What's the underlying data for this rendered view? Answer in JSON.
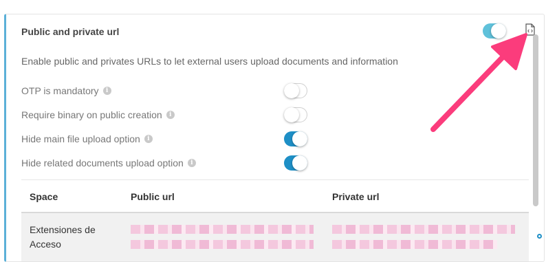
{
  "section": {
    "title": "Public and private url",
    "description": "Enable public and privates URLs to let external users upload documents and information",
    "main_toggle_on": true
  },
  "options": [
    {
      "label": "OTP is mandatory",
      "enabled": false
    },
    {
      "label": "Require binary on public creation",
      "enabled": false
    },
    {
      "label": "Hide main file upload option",
      "enabled": true
    },
    {
      "label": "Hide related documents upload option",
      "enabled": true
    }
  ],
  "table": {
    "headers": {
      "space": "Space",
      "public_url": "Public url",
      "private_url": "Private url"
    },
    "rows": [
      {
        "space": "Extensiones de Acceso"
      }
    ]
  },
  "icons": {
    "code_file": "file-code-icon",
    "info": "info-icon",
    "annotation": "arrow-annotation"
  },
  "colors": {
    "accent": "#1e8fc6",
    "left_border": "#5bb0d8",
    "arrow": "#fb3c7c"
  }
}
